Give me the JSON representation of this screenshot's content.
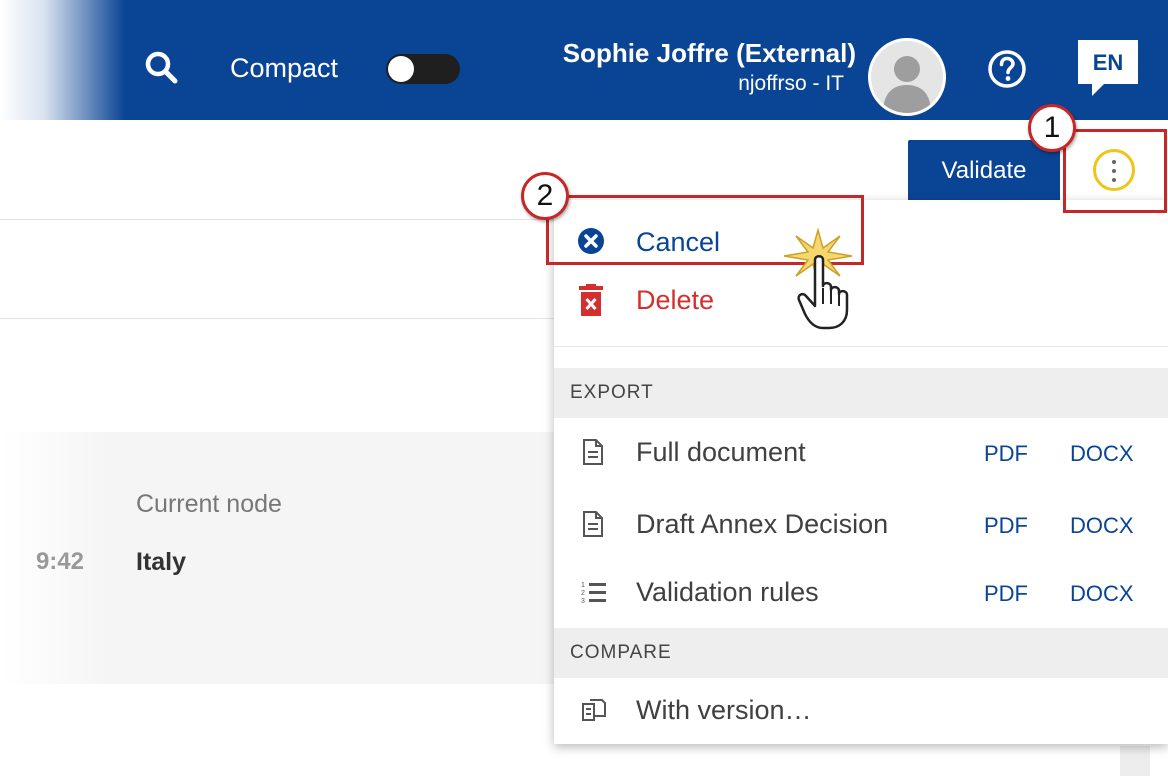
{
  "header": {
    "compact_label": "Compact",
    "user_name": "Sophie Joffre (External)",
    "user_sub": "njoffrso - IT",
    "lang": "EN"
  },
  "toolbar": {
    "validate_label": "Validate"
  },
  "callouts": [
    "1",
    "2"
  ],
  "background": {
    "time_fragment": "9:42",
    "node_label": "Current node",
    "node_value": "Italy"
  },
  "menu": {
    "cancel_label": "Cancel",
    "delete_label": "Delete",
    "export_heading": "EXPORT",
    "export_items": [
      {
        "label": "Full document",
        "formats": [
          "PDF",
          "DOCX"
        ]
      },
      {
        "label": "Draft Annex Decision",
        "formats": [
          "PDF",
          "DOCX"
        ]
      },
      {
        "label": "Validation rules",
        "formats": [
          "PDF",
          "DOCX"
        ]
      }
    ],
    "compare_heading": "COMPARE",
    "compare_item": "With version…"
  },
  "colors": {
    "header_bg": "#0a4494",
    "link": "#0a4494",
    "danger": "#d32f2f",
    "callout": "#c62828",
    "focus_ring": "#f0c419"
  }
}
